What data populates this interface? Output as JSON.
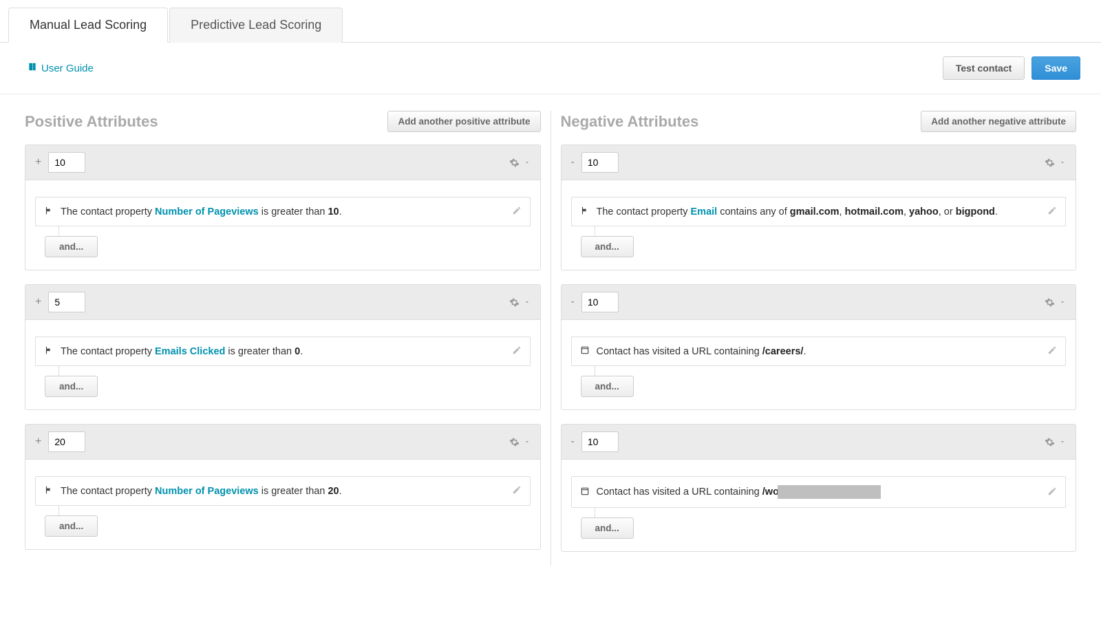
{
  "tabs": {
    "manual": "Manual Lead Scoring",
    "predictive": "Predictive Lead Scoring"
  },
  "toolbar": {
    "user_guide": "User Guide",
    "test_contact": "Test contact",
    "save": "Save"
  },
  "positive": {
    "title": "Positive Attributes",
    "add_label": "Add another positive attribute",
    "sign": "+",
    "cards": [
      {
        "score": "10",
        "rule": {
          "prefix": "The contact property ",
          "link": "Number of Pageviews",
          "mid": " is greater than ",
          "value": "10",
          "suffix": "."
        },
        "and": "and..."
      },
      {
        "score": "5",
        "rule": {
          "prefix": "The contact property ",
          "link": "Emails Clicked",
          "mid": " is greater than ",
          "value": "0",
          "suffix": "."
        },
        "and": "and..."
      },
      {
        "score": "20",
        "rule": {
          "prefix": "The contact property ",
          "link": "Number of Pageviews",
          "mid": " is greater than ",
          "value": "20",
          "suffix": "."
        },
        "and": "and..."
      }
    ]
  },
  "negative": {
    "title": "Negative Attributes",
    "add_label": "Add another negative attribute",
    "sign": "-",
    "cards": [
      {
        "score": "10",
        "rule_type": "email_domains",
        "rule": {
          "prefix": "The contact property ",
          "link": "Email",
          "mid": " contains any of ",
          "v1": "gmail.com",
          "c1": ", ",
          "v2": "hotmail.com",
          "c2": ", ",
          "v3": "yahoo",
          "c3": ", or ",
          "v4": "bigpond",
          "suffix": "."
        },
        "and": "and..."
      },
      {
        "score": "10",
        "rule_type": "url",
        "rule": {
          "prefix": "Contact has visited a URL containing ",
          "value": "/careers/",
          "suffix": "."
        },
        "and": "and..."
      },
      {
        "score": "10",
        "rule_type": "url_redacted",
        "rule": {
          "prefix": "Contact has visited a URL containing ",
          "value": "/wo"
        },
        "and": "and..."
      }
    ]
  }
}
